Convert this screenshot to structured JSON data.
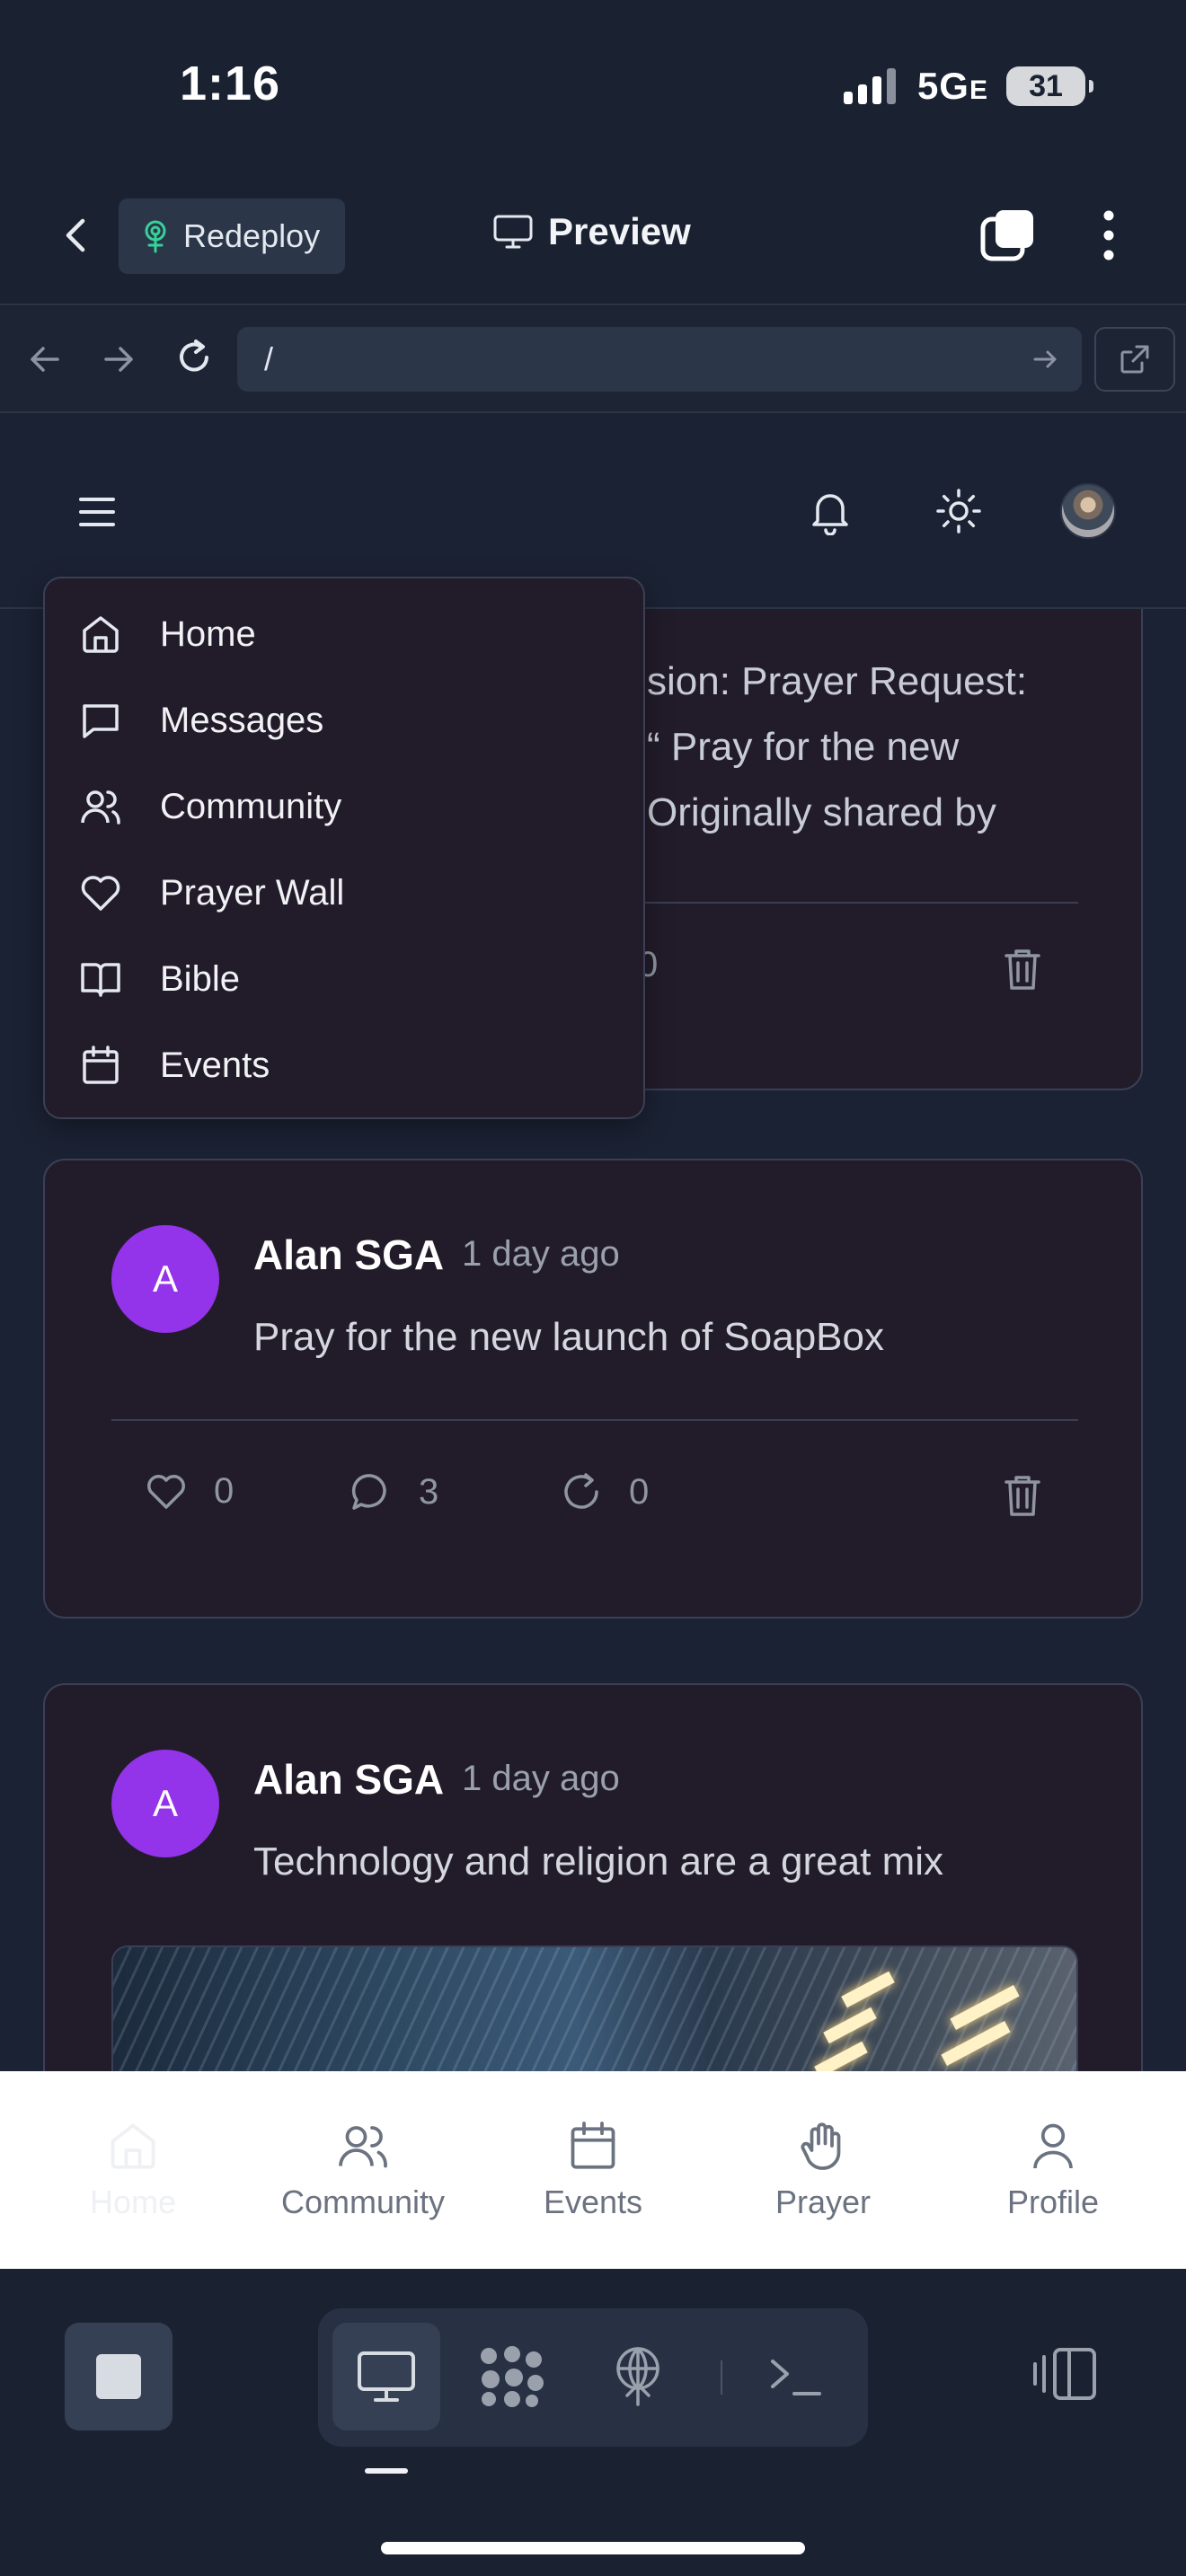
{
  "status_bar": {
    "time": "1:16",
    "network": "5G",
    "network_suffix": "E",
    "battery": "31"
  },
  "header": {
    "redeploy_label": "Redeploy",
    "preview_label": "Preview"
  },
  "browser": {
    "url": "/"
  },
  "menu": {
    "items": [
      {
        "label": "Home",
        "icon": "home-icon"
      },
      {
        "label": "Messages",
        "icon": "message-icon"
      },
      {
        "label": "Community",
        "icon": "users-icon"
      },
      {
        "label": "Prayer Wall",
        "icon": "heart-icon"
      },
      {
        "label": "Bible",
        "icon": "book-icon"
      },
      {
        "label": "Events",
        "icon": "calendar-icon"
      }
    ]
  },
  "partial_post": {
    "lines": [
      "sion: Prayer Request:",
      "“ Pray for the new",
      "Originally shared by"
    ],
    "likes": "0"
  },
  "posts": [
    {
      "avatar_letter": "A",
      "author": "Alan SGA",
      "time": "1 day ago",
      "text": "Pray for the new launch of SoapBox",
      "likes": "0",
      "comments": "3",
      "reposts": "0"
    },
    {
      "avatar_letter": "A",
      "author": "Alan SGA",
      "time": "1 day ago",
      "text": "Technology and religion are a great mix"
    }
  ],
  "bottom_nav": {
    "items": [
      {
        "label": "Home",
        "active": true
      },
      {
        "label": "Community"
      },
      {
        "label": "Events"
      },
      {
        "label": "Prayer"
      },
      {
        "label": "Profile"
      }
    ]
  },
  "colors": {
    "accent_purple": "#9333ea",
    "card_bg": "#221c2a",
    "page_bg": "#1b2233"
  }
}
